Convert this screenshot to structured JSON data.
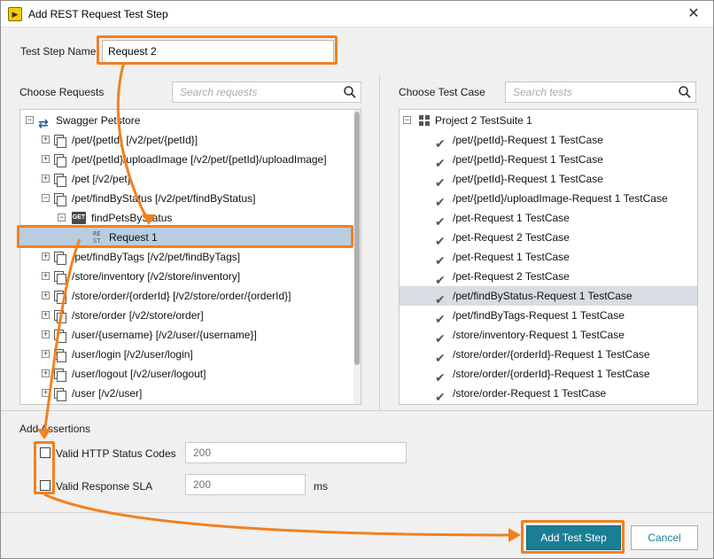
{
  "window": {
    "title": "Add REST Request Test Step",
    "close_glyph": "✕"
  },
  "step_name": {
    "label": "Test Step Name",
    "value": "Request 2"
  },
  "requests_panel": {
    "title": "Choose Requests",
    "search_placeholder": "Search requests",
    "items": {
      "root": "Swagger Petstore",
      "r0": "/pet/{petId} [/v2/pet/{petId}]",
      "r1": "/pet/{petId}/uploadImage [/v2/pet/{petId}/uploadImage]",
      "r2": "/pet [/v2/pet]",
      "r3": "/pet/findByStatus [/v2/pet/findByStatus]",
      "r3_method_badge": "GET",
      "r3_method": "findPetsByStatus",
      "r3_request_badge_top": "RE",
      "r3_request_badge_bottom": "ST",
      "r3_request": "Request 1",
      "r4": "/pet/findByTags [/v2/pet/findByTags]",
      "r5": "/store/inventory [/v2/store/inventory]",
      "r6": "/store/order/{orderId} [/v2/store/order/{orderId}]",
      "r7": "/store/order [/v2/store/order]",
      "r8": "/user/{username} [/v2/user/{username}]",
      "r9": "/user/login [/v2/user/login]",
      "r10": "/user/logout [/v2/user/logout]",
      "r11": "/user [/v2/user]"
    }
  },
  "testcase_panel": {
    "title": "Choose Test Case",
    "search_placeholder": "Search tests",
    "root": "Project 2 TestSuite 1",
    "items": [
      "/pet/{petId}-Request 1 TestCase",
      "/pet/{petId}-Request 1 TestCase",
      "/pet/{petId}-Request 1 TestCase",
      "/pet/{petId}/uploadImage-Request 1 TestCase",
      "/pet-Request 1 TestCase",
      "/pet-Request 2 TestCase",
      "/pet-Request 1 TestCase",
      "/pet-Request 2 TestCase",
      "/pet/findByStatus-Request 1 TestCase",
      "/pet/findByTags-Request 1 TestCase",
      "/store/inventory-Request 1 TestCase",
      "/store/order/{orderId}-Request 1 TestCase",
      "/store/order/{orderId}-Request 1 TestCase",
      "/store/order-Request 1 TestCase"
    ]
  },
  "assertions": {
    "title": "Add Assertions",
    "status_codes_label": "Valid HTTP Status Codes",
    "status_codes_value": "200",
    "sla_label": "Valid Response SLA",
    "sla_value": "200",
    "sla_unit": "ms"
  },
  "buttons": {
    "add": "Add Test Step",
    "cancel": "Cancel"
  },
  "colors": {
    "accent": "#1a7f94",
    "highlight": "#f2801f",
    "selection": "#b8cde0"
  }
}
